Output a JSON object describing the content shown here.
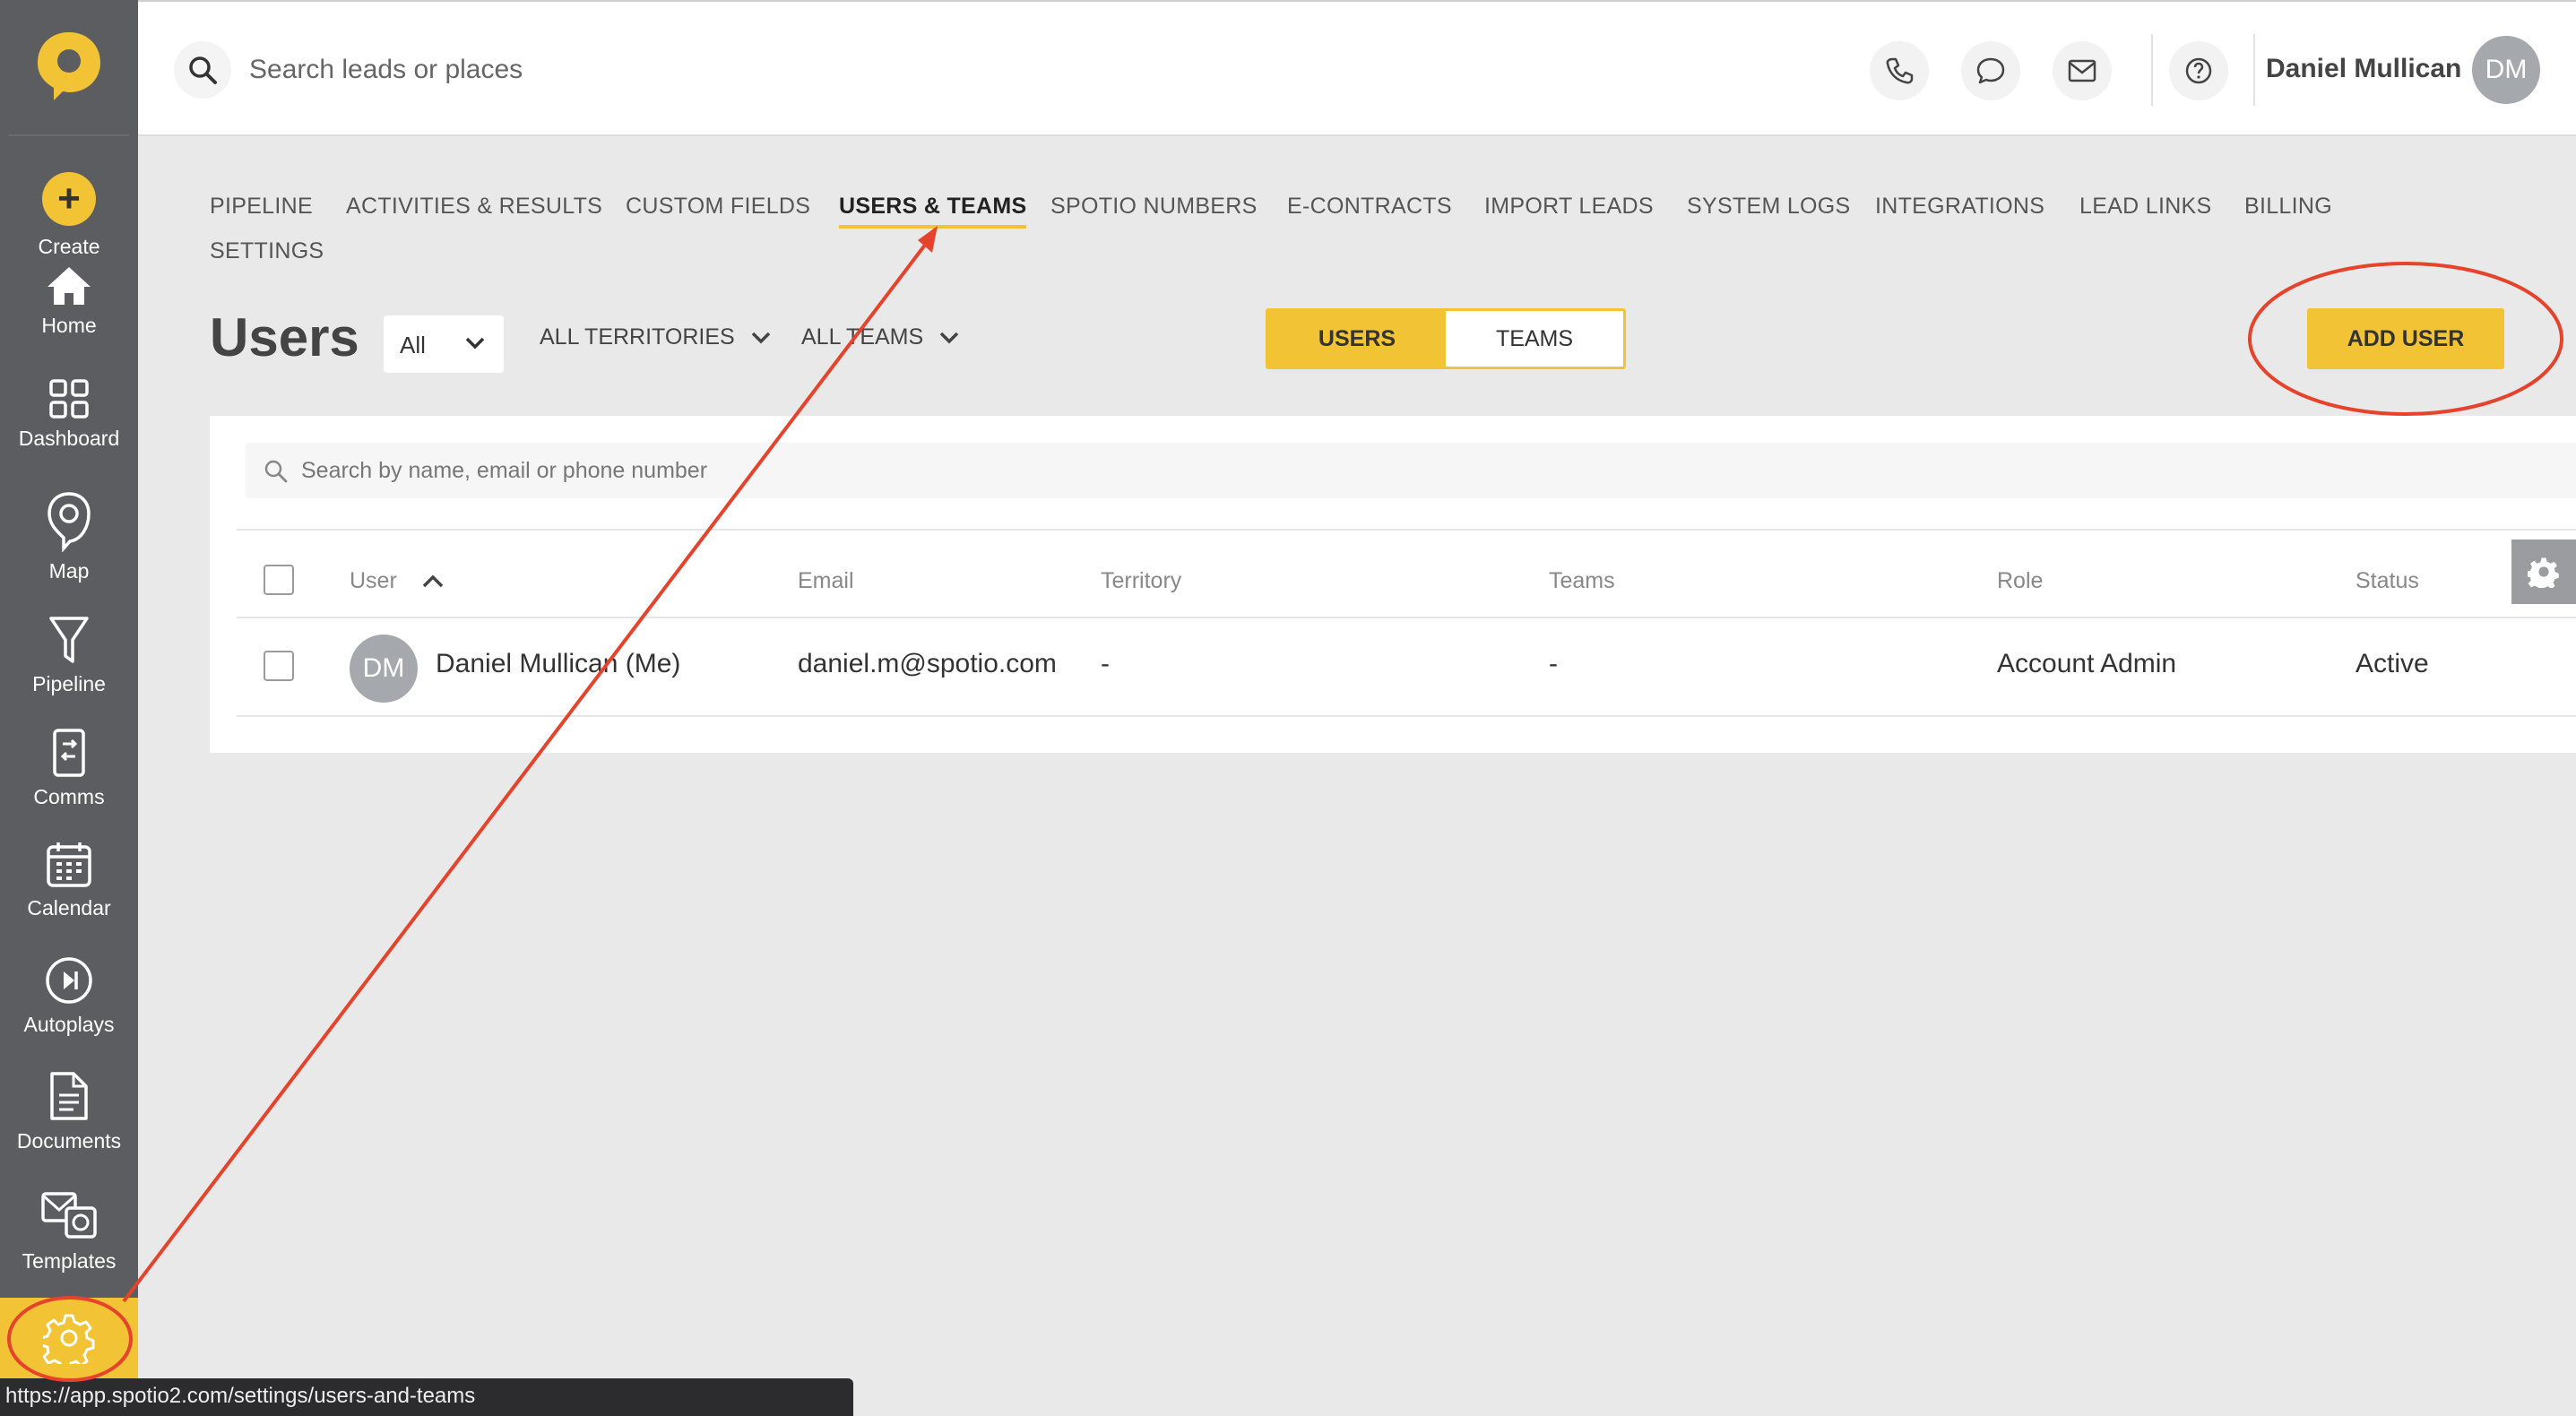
{
  "sidebar": {
    "items": [
      {
        "label": "Create"
      },
      {
        "label": "Home"
      },
      {
        "label": "Dashboard"
      },
      {
        "label": "Map"
      },
      {
        "label": "Pipeline"
      },
      {
        "label": "Comms"
      },
      {
        "label": "Calendar"
      },
      {
        "label": "Autoplays"
      },
      {
        "label": "Documents"
      },
      {
        "label": "Templates"
      }
    ],
    "active_item": "Settings"
  },
  "header": {
    "search_placeholder": "Search leads or places",
    "user_name": "Daniel Mullican",
    "user_initials": "DM"
  },
  "settings_tabs": [
    "PIPELINE",
    "ACTIVITIES & RESULTS",
    "CUSTOM FIELDS",
    "USERS & TEAMS",
    "SPOTIO NUMBERS",
    "E-CONTRACTS",
    "IMPORT LEADS",
    "SYSTEM LOGS",
    "INTEGRATIONS",
    "LEAD LINKS",
    "BILLING",
    "SETTINGS"
  ],
  "active_tab": "USERS & TEAMS",
  "page": {
    "title": "Users",
    "filter_all": "All",
    "territories_dropdown": "ALL TERRITORIES",
    "teams_dropdown": "ALL TEAMS",
    "toggle": {
      "users": "USERS",
      "teams": "TEAMS",
      "selected": "USERS"
    },
    "add_user_label": "ADD USER"
  },
  "table": {
    "search_placeholder": "Search by name, email or phone number",
    "columns": [
      "User",
      "Email",
      "Territory",
      "Teams",
      "Role",
      "Status"
    ],
    "sort_column": "User",
    "rows": [
      {
        "initials": "DM",
        "user": "Daniel Mullican (Me)",
        "email": "daniel.m@spotio.com",
        "territory": "-",
        "teams": "-",
        "role": "Account Admin",
        "status": "Active"
      }
    ]
  },
  "status_url": "https://app.spotio2.com/settings/users-and-teams",
  "colors": {
    "accent": "#f2c335",
    "sidebar": "#5b5d61",
    "annotation": "#e5432b"
  }
}
